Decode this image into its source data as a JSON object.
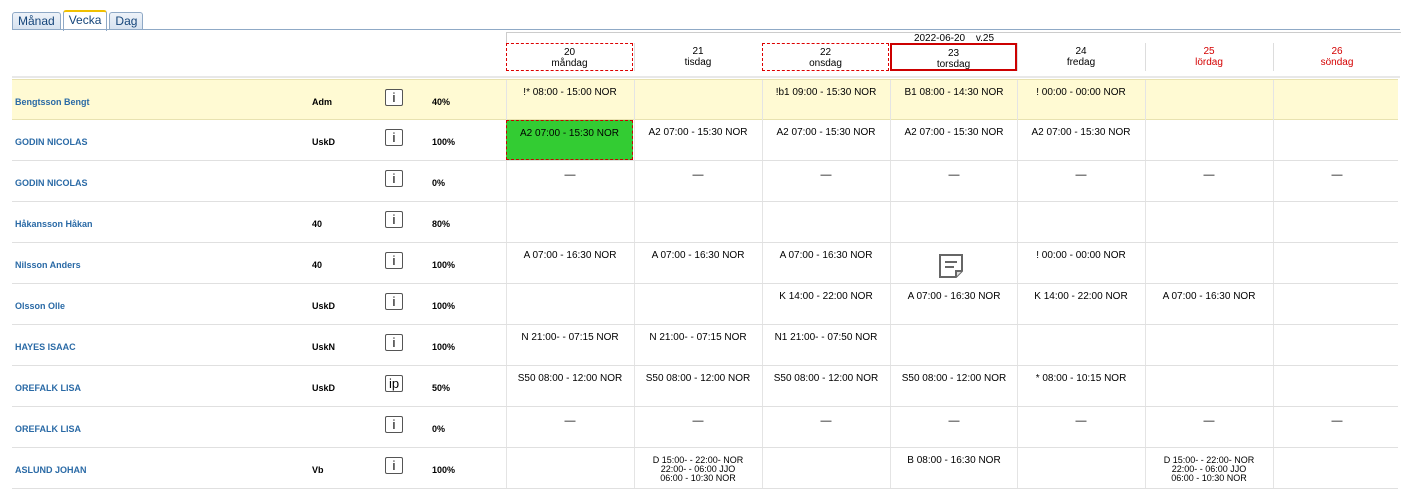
{
  "tabs": [
    {
      "label": "Månad"
    },
    {
      "label": "Vecka",
      "active": true
    },
    {
      "label": "Dag"
    }
  ],
  "header": {
    "date": "2022-06-20",
    "week": "v.25"
  },
  "days": [
    {
      "num": "20",
      "name": "måndag",
      "style": "dashed"
    },
    {
      "num": "21",
      "name": "tisdag",
      "style": ""
    },
    {
      "num": "22",
      "name": "onsdag",
      "style": "dashed"
    },
    {
      "num": "23",
      "name": "torsdag",
      "style": "today"
    },
    {
      "num": "24",
      "name": "fredag",
      "style": ""
    },
    {
      "num": "25",
      "name": "lördag",
      "style": "red"
    },
    {
      "num": "26",
      "name": "söndag",
      "style": "red"
    }
  ],
  "rows": [
    {
      "name": "Bengtsson Bengt",
      "group": "Adm",
      "info": "i",
      "pct": "40%",
      "highlight": true,
      "cells": [
        "!* 08:00 - 15:00 NOR",
        "",
        "!b1 09:00 - 15:30 NOR",
        "B1 08:00 - 14:30 NOR",
        "! 00:00 - 00:00 NOR",
        "",
        ""
      ]
    },
    {
      "name": "GODIN NICOLAS",
      "group": "UskD",
      "info": "i",
      "pct": "100%",
      "cells": [
        "A2 07:00 - 15:30 NOR",
        "A2 07:00 - 15:30 NOR",
        "A2 07:00 - 15:30 NOR",
        "A2 07:00 - 15:30 NOR",
        "A2 07:00 - 15:30 NOR",
        "",
        ""
      ],
      "green": [
        0
      ]
    },
    {
      "name": "GODIN NICOLAS",
      "group": "",
      "info": "i",
      "pct": "0%",
      "cells": [
        "—",
        "—",
        "—",
        "—",
        "—",
        "—",
        "—"
      ]
    },
    {
      "name": "Håkansson Håkan",
      "group": "40",
      "info": "i",
      "pct": "80%",
      "cells": [
        "",
        "",
        "",
        "",
        "",
        "",
        ""
      ]
    },
    {
      "name": "Nilsson Anders",
      "group": "40",
      "info": "i",
      "pct": "100%",
      "cells": [
        "A 07:00 - 16:30 NOR",
        "A 07:00 - 16:30 NOR",
        "A 07:00 - 16:30 NOR",
        "",
        "! 00:00 - 00:00 NOR",
        "",
        ""
      ],
      "note": [
        3
      ]
    },
    {
      "name": "Olsson Olle",
      "group": "UskD",
      "info": "i",
      "pct": "100%",
      "cells": [
        "",
        "",
        "K 14:00 - 22:00 NOR",
        "A 07:00 - 16:30 NOR",
        "K 14:00 - 22:00 NOR",
        "A 07:00 - 16:30 NOR",
        ""
      ]
    },
    {
      "name": "HAYES ISAAC",
      "group": "UskN",
      "info": "i",
      "pct": "100%",
      "cells": [
        "N 21:00- - 07:15 NOR",
        "N 21:00- - 07:15 NOR",
        "N1 21:00- - 07:50 NOR",
        "",
        "",
        "",
        ""
      ]
    },
    {
      "name": "OREFALK LISA",
      "group": "UskD",
      "info": "ip",
      "pct": "50%",
      "cells": [
        "S50 08:00 - 12:00 NOR",
        "S50 08:00 - 12:00 NOR",
        "S50 08:00 - 12:00 NOR",
        "S50 08:00 - 12:00 NOR",
        "* 08:00 - 10:15 NOR",
        "",
        ""
      ]
    },
    {
      "name": "OREFALK LISA",
      "group": "",
      "info": "i",
      "pct": "0%",
      "cells": [
        "—",
        "—",
        "—",
        "—",
        "—",
        "—",
        "—"
      ]
    },
    {
      "name": "ASLUND JOHAN",
      "group": "Vb",
      "info": "i",
      "pct": "100%",
      "cells": [
        "",
        "D 15:00- - 22:00- NOR\n22:00- - 06:00 JJO\n06:00 - 10:30 NOR",
        "",
        "B 08:00 - 16:30 NOR",
        "",
        "D 15:00- - 22:00- NOR\n22:00- - 06:00 JJO\n06:00 - 10:30 NOR",
        ""
      ]
    }
  ]
}
